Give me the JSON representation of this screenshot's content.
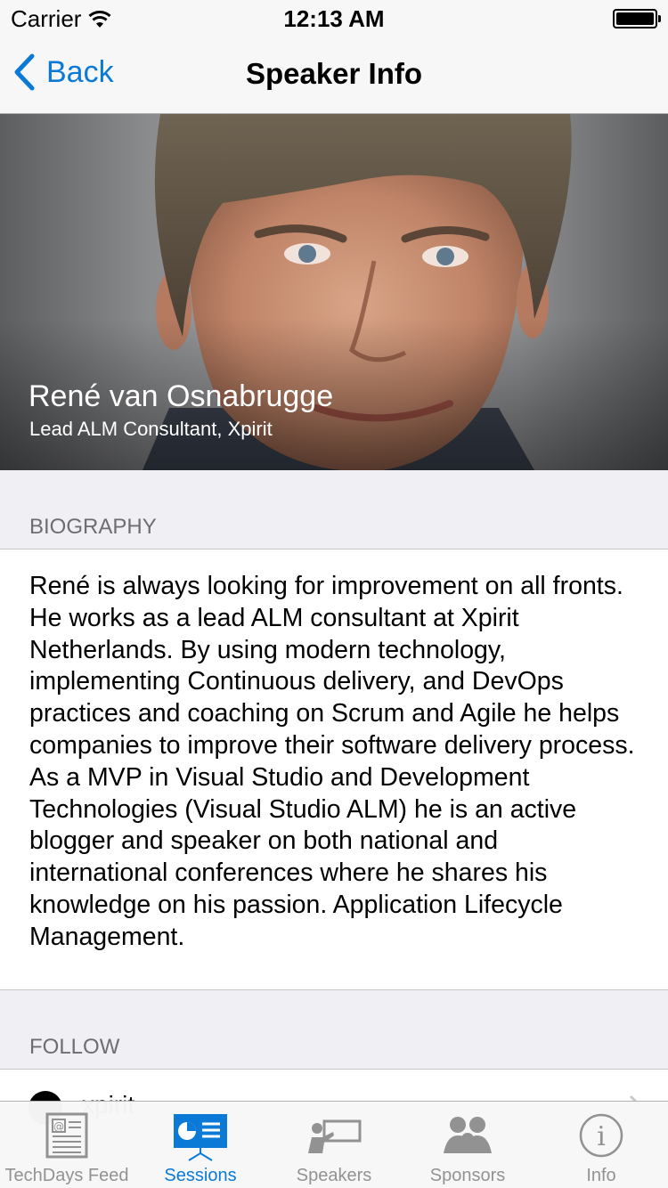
{
  "status_bar": {
    "carrier": "Carrier",
    "time": "12:13 AM"
  },
  "nav": {
    "back_label": "Back",
    "title": "Speaker Info"
  },
  "speaker": {
    "name": "René van Osnabrugge",
    "role": "Lead ALM Consultant, Xpirit"
  },
  "biography": {
    "header": "BIOGRAPHY",
    "text": "René is always looking for improvement on all fronts. He works as a lead ALM consultant at Xpirit Netherlands. By using modern technology, implementing Continuous delivery, and DevOps practices and coaching on Scrum and Agile he helps companies to improve their software delivery process. As a MVP in Visual Studio and Development Technologies (Visual Studio ALM) he is an active blogger and speaker on both national and international conferences where he shares his knowledge on his passion. Application Lifecycle Management."
  },
  "follow": {
    "header": "FOLLOW",
    "first_item": "xpirit"
  },
  "tabs": [
    {
      "label": "TechDays Feed",
      "icon": "newspaper-icon",
      "active": false
    },
    {
      "label": "Sessions",
      "icon": "presentation-icon",
      "active": true
    },
    {
      "label": "Speakers",
      "icon": "speaker-board-icon",
      "active": false
    },
    {
      "label": "Sponsors",
      "icon": "people-group-icon",
      "active": false
    },
    {
      "label": "Info",
      "icon": "info-icon",
      "active": false
    }
  ],
  "colors": {
    "accent": "#0a7ad6",
    "inactive": "#929292",
    "section_bg": "#efeff4"
  }
}
